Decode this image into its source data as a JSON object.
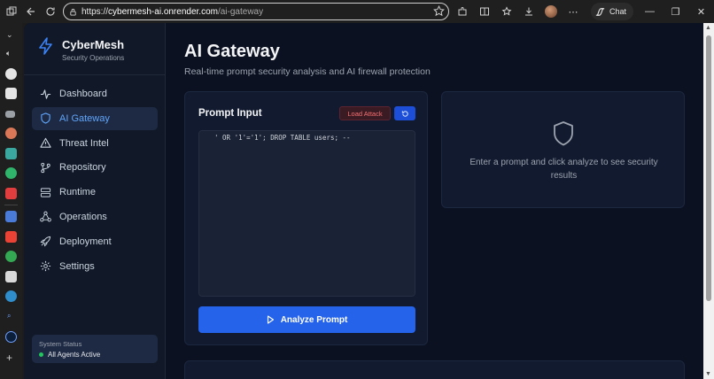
{
  "browser": {
    "url_prefix": "https://",
    "url_host": "cybermesh-ai.onrender.com",
    "url_path": "/ai-gateway",
    "chat_label": "Chat"
  },
  "sidebar": {
    "brand_title": "CyberMesh",
    "brand_subtitle": "Security Operations",
    "items": [
      {
        "label": "Dashboard",
        "icon": "activity-icon"
      },
      {
        "label": "AI Gateway",
        "icon": "shield-icon",
        "active": true
      },
      {
        "label": "Threat Intel",
        "icon": "warning-icon"
      },
      {
        "label": "Repository",
        "icon": "git-branch-icon"
      },
      {
        "label": "Runtime",
        "icon": "server-icon"
      },
      {
        "label": "Operations",
        "icon": "network-icon"
      },
      {
        "label": "Deployment",
        "icon": "rocket-icon"
      },
      {
        "label": "Settings",
        "icon": "gear-icon"
      }
    ],
    "status_label": "System Status",
    "status_value": "All Agents Active"
  },
  "main": {
    "title": "AI Gateway",
    "subtitle": "Real-time prompt security analysis and AI firewall protection",
    "prompt_card": {
      "heading": "Prompt Input",
      "load_attack_label": "Load Attack",
      "prompt_value": "' OR '1'='1'; DROP TABLE users; --",
      "analyze_label": "Analyze Prompt"
    },
    "result_card": {
      "empty_text": "Enter a prompt and click analyze to see security results"
    }
  },
  "colors": {
    "accent": "#2563eb",
    "active_nav": "#60a5fa",
    "status_ok": "#22c55e",
    "danger": "#f87171"
  }
}
